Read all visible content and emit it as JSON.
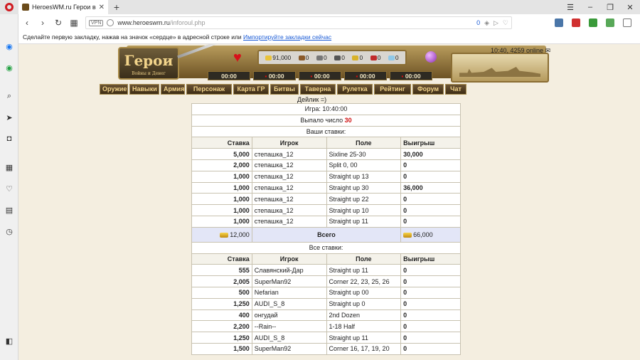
{
  "browser": {
    "tab_title": "HeroesWM.ru Герои войн",
    "new_tab": "+",
    "url_host": "www.heroeswm.ru",
    "url_path": "/inforoul.php",
    "vpn_label": "VPN",
    "adblock_count": "0",
    "bookmark_hint": "Сделайте первую закладку, нажав на значок «сердце» в адресной строке или",
    "bookmark_import": "Импортируйте закладки сейчас"
  },
  "game": {
    "logo_title": "Герои",
    "logo_subtitle": "Войны и Денег",
    "clock": "10:40, 4259 online",
    "resources": [
      "91,000",
      "0",
      "0",
      "0",
      "0",
      "0",
      "0"
    ],
    "timers": [
      "00:00",
      "00:00",
      "00:00",
      "00:00",
      "00:00"
    ],
    "menu": [
      "Оружие",
      "Навыки",
      "Армия",
      "Персонаж",
      "Карта ГР",
      "Битвы",
      "Таверна",
      "Рулетка",
      "Рейтинг",
      "Форум",
      "Чат"
    ]
  },
  "roulette": {
    "dealer": "Дейлик =)",
    "game_time": "Игра: 10:40:00",
    "result_prefix": "Выпало число",
    "result_number": "30",
    "your_bets_title": "Ваши ставки:",
    "all_bets_title": "Все ставки:",
    "columns": [
      "Ставка",
      "Игрок",
      "Поле",
      "Выигрыш"
    ],
    "your_bets": [
      {
        "bet": "5,000",
        "player": "степашка_12",
        "field": "Sixline 25-30",
        "win": "30,000"
      },
      {
        "bet": "2,000",
        "player": "степашка_12",
        "field": "Split 0, 00",
        "win": "0"
      },
      {
        "bet": "1,000",
        "player": "степашка_12",
        "field": "Straight up 13",
        "win": "0"
      },
      {
        "bet": "1,000",
        "player": "степашка_12",
        "field": "Straight up 30",
        "win": "36,000"
      },
      {
        "bet": "1,000",
        "player": "степашка_12",
        "field": "Straight up 22",
        "win": "0"
      },
      {
        "bet": "1,000",
        "player": "степашка_12",
        "field": "Straight up 10",
        "win": "0"
      },
      {
        "bet": "1,000",
        "player": "степашка_12",
        "field": "Straight up 11",
        "win": "0"
      }
    ],
    "total": {
      "bet": "12,000",
      "label": "Всего",
      "win": "66,000"
    },
    "all_bets": [
      {
        "bet": "555",
        "player": "Славянский-Дар",
        "field": "Straight up 11",
        "win": "0"
      },
      {
        "bet": "2,005",
        "player": "SuperMan92",
        "field": "Corner 22, 23, 25, 26",
        "win": "0"
      },
      {
        "bet": "500",
        "player": "Nefarian",
        "field": "Straight up 00",
        "win": "0"
      },
      {
        "bet": "1,250",
        "player": "AUDI_S_8",
        "field": "Straight up 0",
        "win": "0"
      },
      {
        "bet": "400",
        "player": "онгудай",
        "field": "2nd Dozen",
        "win": "0"
      },
      {
        "bet": "2,200",
        "player": "--Rain--",
        "field": "1-18 Half",
        "win": "0"
      },
      {
        "bet": "1,250",
        "player": "AUDI_S_8",
        "field": "Straight up 11",
        "win": "0"
      },
      {
        "bet": "1,500",
        "player": "SuperMan92",
        "field": "Corner 16, 17, 19, 20",
        "win": "0"
      }
    ]
  }
}
